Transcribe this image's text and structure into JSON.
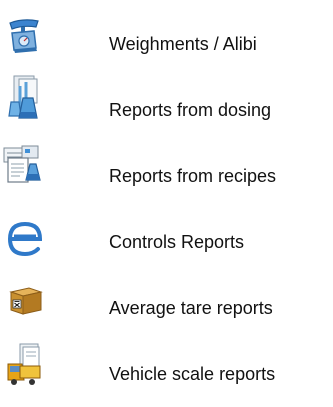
{
  "menu": {
    "items": [
      {
        "label": "Weighments / Alibi",
        "icon": "scale-icon"
      },
      {
        "label": "Reports from dosing",
        "icon": "flasks-icon"
      },
      {
        "label": "Reports from recipes",
        "icon": "recipe-documents-icon"
      },
      {
        "label": "Controls Reports",
        "icon": "controls-e-icon"
      },
      {
        "label": "Average tare reports",
        "icon": "tare-box-icon"
      },
      {
        "label": "Vehicle scale reports",
        "icon": "truck-document-icon"
      }
    ]
  },
  "colors": {
    "text": "#111111",
    "background": "#ffffff",
    "icon_blue": "#2f79c9",
    "icon_box": "#c9902f"
  }
}
